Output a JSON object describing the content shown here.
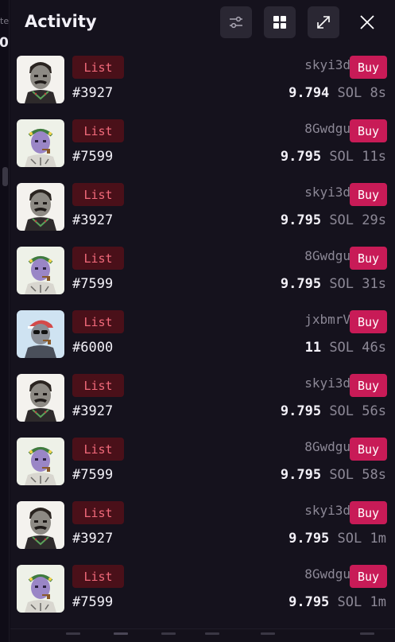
{
  "background_fragments": {
    "text1": "te",
    "text2": "0."
  },
  "header": {
    "title": "Activity"
  },
  "icons": {
    "filter": "filter-sliders-icon",
    "grid": "grid-view-icon",
    "expand": "expand-icon",
    "close": "close-icon"
  },
  "colors": {
    "panel_bg": "#15121d",
    "list_badge_bg": "#4a1019",
    "list_badge_text": "#f26a7b",
    "buy_button": "#c81b57"
  },
  "activities": [
    {
      "type": "List",
      "token": "#3927",
      "seller": "skyi3d",
      "action": "Buy",
      "price": "9.794",
      "currency": "SOL",
      "age": "8s",
      "avatar": "mustache-man"
    },
    {
      "type": "List",
      "token": "#7599",
      "seller": "8Gwdgu",
      "action": "Buy",
      "price": "9.795",
      "currency": "SOL",
      "age": "11s",
      "avatar": "purple-pipe"
    },
    {
      "type": "List",
      "token": "#3927",
      "seller": "skyi3d",
      "action": "Buy",
      "price": "9.795",
      "currency": "SOL",
      "age": "29s",
      "avatar": "mustache-man"
    },
    {
      "type": "List",
      "token": "#7599",
      "seller": "8Gwdgu",
      "action": "Buy",
      "price": "9.795",
      "currency": "SOL",
      "age": "31s",
      "avatar": "purple-pipe"
    },
    {
      "type": "List",
      "token": "#6000",
      "seller": "jxbmrV",
      "action": "Buy",
      "price": "11",
      "currency": "SOL",
      "age": "46s",
      "avatar": "cap-shades"
    },
    {
      "type": "List",
      "token": "#3927",
      "seller": "skyi3d",
      "action": "Buy",
      "price": "9.795",
      "currency": "SOL",
      "age": "56s",
      "avatar": "mustache-man"
    },
    {
      "type": "List",
      "token": "#7599",
      "seller": "8Gwdgu",
      "action": "Buy",
      "price": "9.795",
      "currency": "SOL",
      "age": "58s",
      "avatar": "purple-pipe"
    },
    {
      "type": "List",
      "token": "#3927",
      "seller": "skyi3d",
      "action": "Buy",
      "price": "9.795",
      "currency": "SOL",
      "age": "1m",
      "avatar": "mustache-man"
    },
    {
      "type": "List",
      "token": "#7599",
      "seller": "8Gwdgu",
      "action": "Buy",
      "price": "9.795",
      "currency": "SOL",
      "age": "1m",
      "avatar": "purple-pipe"
    }
  ]
}
